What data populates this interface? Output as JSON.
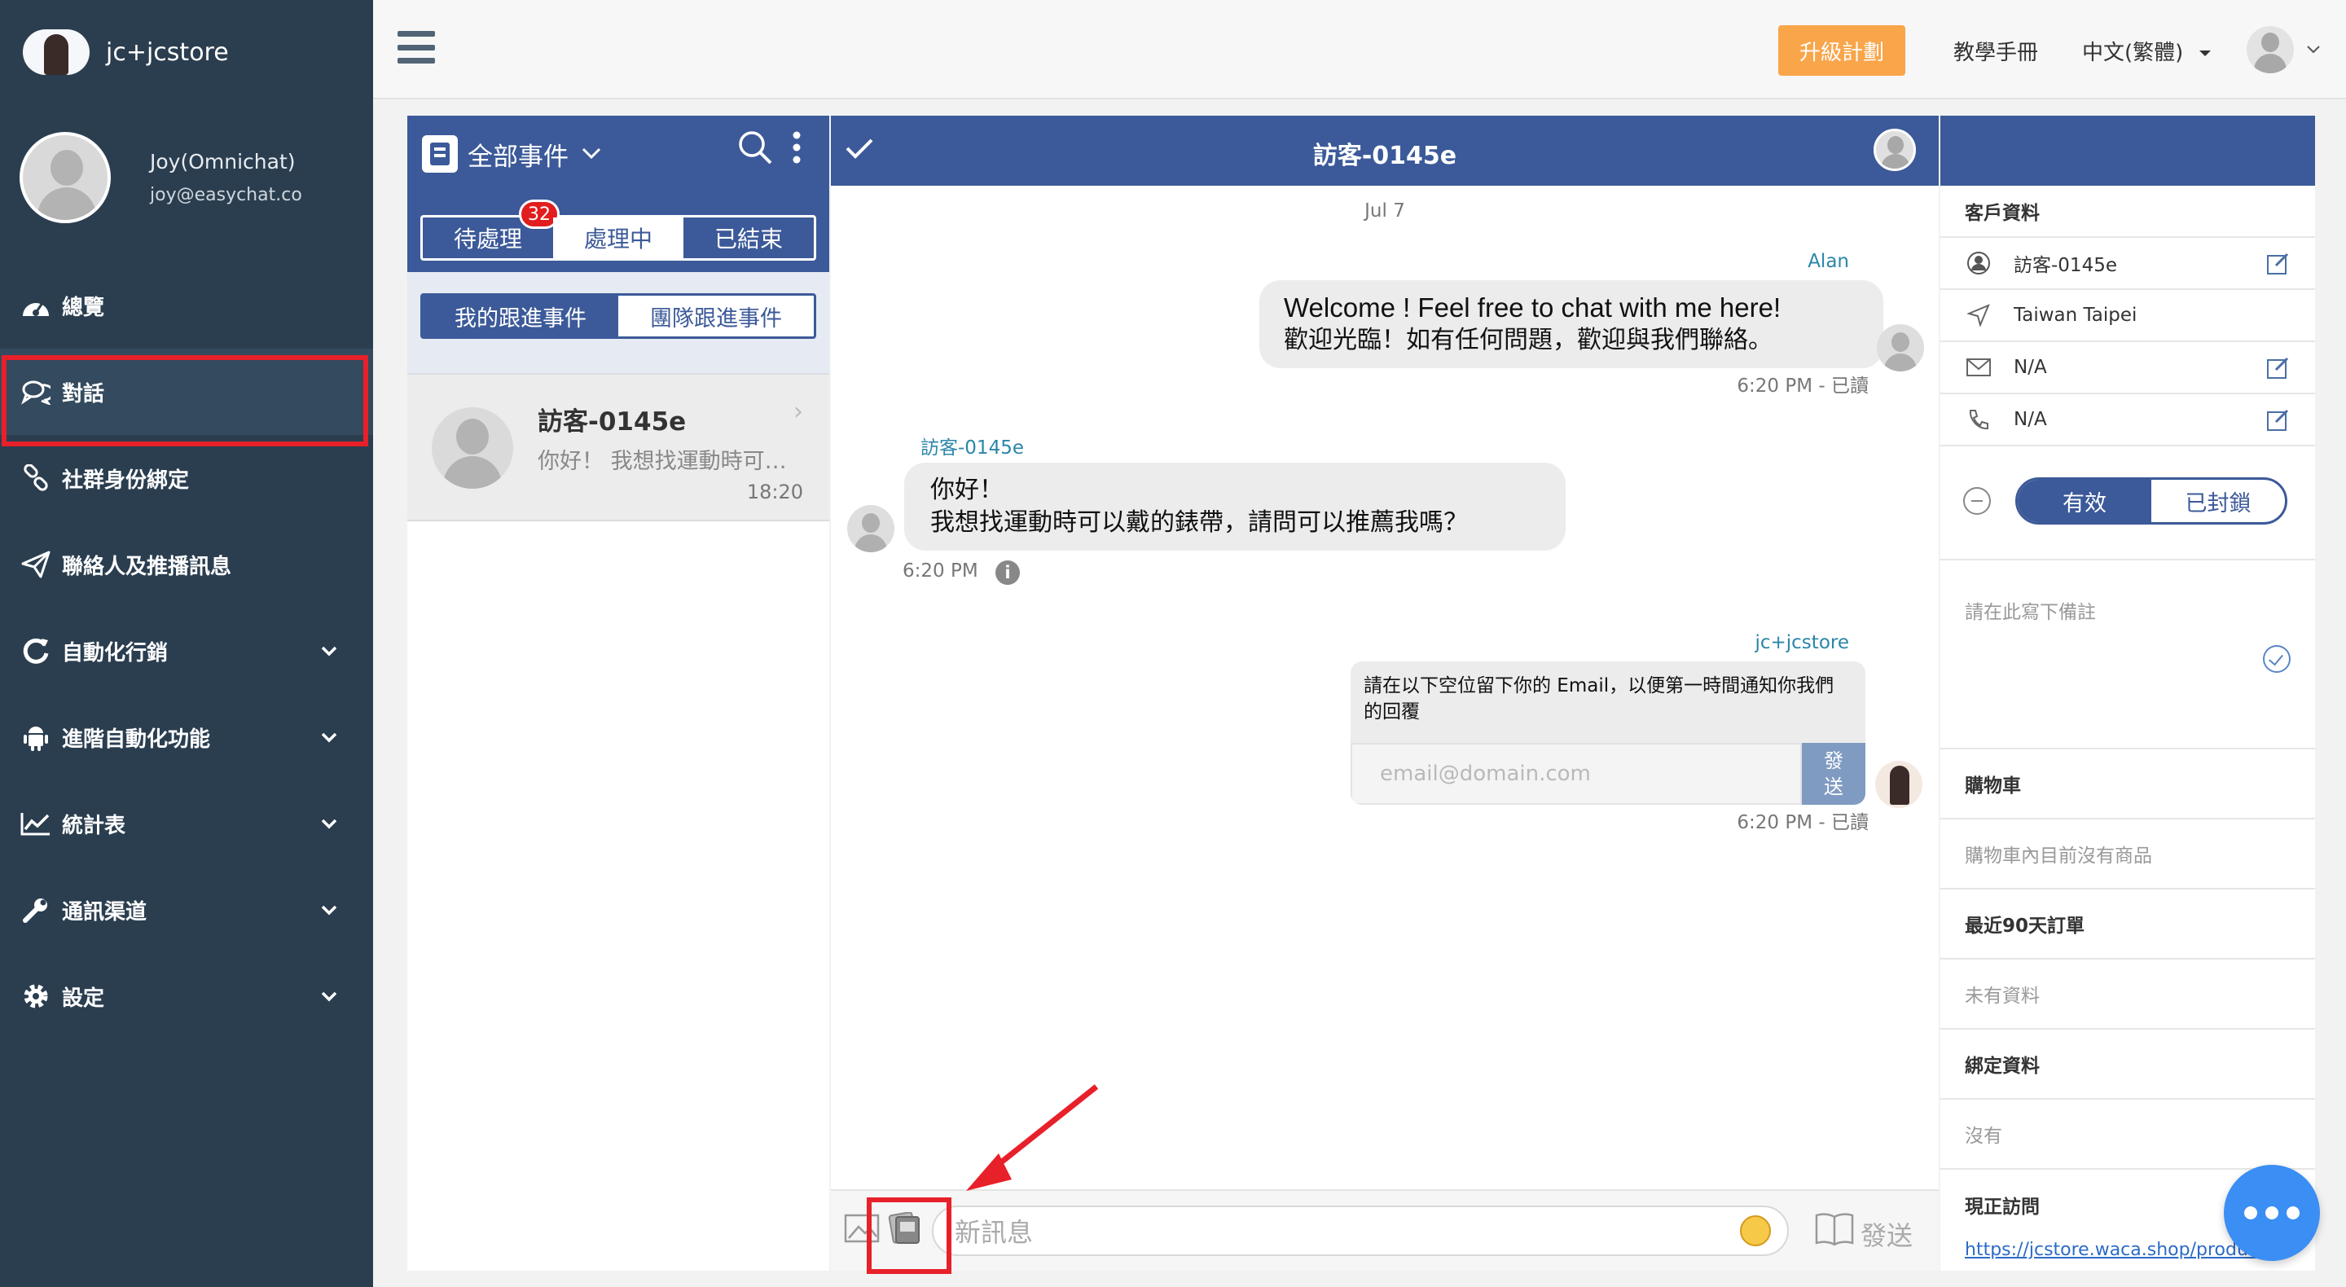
{
  "brand": {
    "name": "jc+jcstore"
  },
  "profile": {
    "name": "Joy(Omnichat)",
    "email": "joy@easychat.co"
  },
  "nav": [
    {
      "label": "總覽",
      "icon": "dashboard-icon",
      "has_submenu": false,
      "active": false
    },
    {
      "label": "對話",
      "icon": "chat-icon",
      "has_submenu": false,
      "active": true
    },
    {
      "label": "社群身份綁定",
      "icon": "link-icon",
      "has_submenu": false,
      "active": false
    },
    {
      "label": "聯絡人及推播訊息",
      "icon": "send-icon",
      "has_submenu": false,
      "active": false
    },
    {
      "label": "自動化行銷",
      "icon": "refresh-icon",
      "has_submenu": true,
      "active": false
    },
    {
      "label": "進階自動化功能",
      "icon": "android-icon",
      "has_submenu": true,
      "active": false
    },
    {
      "label": "統計表",
      "icon": "line-chart-icon",
      "has_submenu": true,
      "active": false
    },
    {
      "label": "通訊渠道",
      "icon": "wrench-icon",
      "has_submenu": true,
      "active": false
    },
    {
      "label": "設定",
      "icon": "gear-icon",
      "has_submenu": true,
      "active": false
    }
  ],
  "topbar": {
    "upgrade": "升級計劃",
    "manual": "教學手冊",
    "language": "中文(繁體)"
  },
  "list": {
    "title": "全部事件",
    "state_tabs": [
      {
        "label": "待處理",
        "badge": "32",
        "selected": false
      },
      {
        "label": "處理中",
        "selected": true
      },
      {
        "label": "已結束",
        "selected": false
      }
    ],
    "scope_tabs": [
      {
        "label": "我的跟進事件",
        "selected": true
      },
      {
        "label": "團隊跟進事件",
        "selected": false
      }
    ],
    "conversations": [
      {
        "name": "訪客-0145e",
        "preview": "你好！ 我想找運動時可以戴的錶帶，請問可以推薦我嗎？",
        "time": "18:20"
      }
    ]
  },
  "chat": {
    "title": "訪客-0145e",
    "date": "Jul 7",
    "messages": [
      {
        "sender": "Alan",
        "line1": "Welcome ! Feel free to chat with me here!",
        "line2": "歡迎光臨！如有任何問題，歡迎與我們聯絡。",
        "meta": "6:20 PM - 已讀"
      },
      {
        "sender": "訪客-0145e",
        "line1": "你好！",
        "line2": "我想找運動時可以戴的錶帶，請問可以推薦我嗎？",
        "meta": "6:20 PM"
      },
      {
        "sender": "jc+jcstore",
        "text": "請在以下空位留下你的 Email，以便第一時間通知你我們的回覆",
        "input_placeholder": "email@domain.com",
        "button": "發送",
        "meta": "6:20 PM - 已讀"
      }
    ],
    "composer": {
      "placeholder": "新訊息",
      "send": "發送"
    }
  },
  "info": {
    "customer_title": "客戶資料",
    "name": "訪客-0145e",
    "location": "Taiwan Taipei",
    "email": "N/A",
    "phone": "N/A",
    "status_active": "有效",
    "status_blocked": "已封鎖",
    "note_placeholder": "請在此寫下備註",
    "cart_title": "購物車",
    "cart_empty": "購物車內目前沒有商品",
    "orders_title": "最近90天訂單",
    "orders_empty": "未有資料",
    "binding_title": "綁定資料",
    "binding_empty": "沒有",
    "visiting_title": "現正訪問",
    "visiting_url": "https://jcstore.waca.shop/product"
  },
  "colors": {
    "sidebar": "#2b3e50",
    "primary": "#3c5a99",
    "upgrade": "#f9a54a",
    "highlight": "#e8202a",
    "fab": "#3b8ef3"
  }
}
